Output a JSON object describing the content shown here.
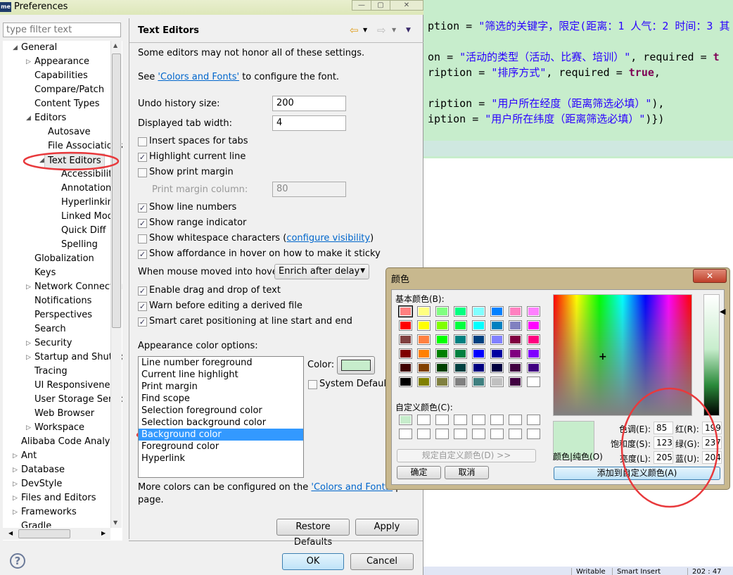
{
  "editor": {
    "bg_color": "#c7edcc",
    "lines": [
      {
        "segs": [
          [
            "ption = ",
            ""
          ],
          [
            "\"筛选的关键字，限定(距离：1 人气：2 时间：3 其",
            "s"
          ]
        ]
      },
      {
        "segs": [
          [
            "on = ",
            ""
          ],
          [
            "\"活动的类型（活动、比赛、培训）\"",
            "s"
          ],
          [
            ", required = ",
            ""
          ],
          [
            "t",
            "k"
          ]
        ]
      },
      {
        "segs": [
          [
            "ription = ",
            ""
          ],
          [
            "\"排序方式\"",
            "s"
          ],
          [
            ", required = ",
            ""
          ],
          [
            "true",
            "k"
          ],
          [
            ",",
            ""
          ]
        ]
      },
      {
        "segs": [
          [
            "ription = ",
            ""
          ],
          [
            "\"用户所在经度（距离筛选必填）\"",
            "s"
          ],
          [
            "),",
            ""
          ]
        ]
      },
      {
        "segs": [
          [
            "iption = ",
            ""
          ],
          [
            "\"用户所在纬度（距离筛选必填）\"",
            "s"
          ],
          [
            ")})",
            ""
          ]
        ]
      }
    ],
    "status": [
      "Writable",
      "Smart Insert",
      "202 : 47"
    ]
  },
  "window": {
    "title": "Preferences",
    "app_icon": "me"
  },
  "filter": {
    "placeholder": "type filter text"
  },
  "tree": [
    {
      "l": 0,
      "a": "open",
      "t": "General"
    },
    {
      "l": 1,
      "a": "closed",
      "t": "Appearance"
    },
    {
      "l": 1,
      "t": "Capabilities"
    },
    {
      "l": 1,
      "t": "Compare/Patch"
    },
    {
      "l": 1,
      "t": "Content Types"
    },
    {
      "l": 1,
      "a": "open",
      "t": "Editors"
    },
    {
      "l": 2,
      "t": "Autosave"
    },
    {
      "l": 2,
      "t": "File Associations"
    },
    {
      "l": 2,
      "a": "open",
      "t": "Text Editors",
      "sel": true
    },
    {
      "l": 3,
      "t": "Accessibility"
    },
    {
      "l": 3,
      "t": "Annotations"
    },
    {
      "l": 3,
      "t": "Hyperlinking"
    },
    {
      "l": 3,
      "t": "Linked Mode"
    },
    {
      "l": 3,
      "t": "Quick Diff"
    },
    {
      "l": 3,
      "t": "Spelling"
    },
    {
      "l": 1,
      "t": "Globalization"
    },
    {
      "l": 1,
      "t": "Keys"
    },
    {
      "l": 1,
      "a": "closed",
      "t": "Network Connections"
    },
    {
      "l": 1,
      "t": "Notifications"
    },
    {
      "l": 1,
      "t": "Perspectives"
    },
    {
      "l": 1,
      "t": "Search"
    },
    {
      "l": 1,
      "a": "closed",
      "t": "Security"
    },
    {
      "l": 1,
      "a": "closed",
      "t": "Startup and Shutdown"
    },
    {
      "l": 1,
      "t": "Tracing"
    },
    {
      "l": 1,
      "t": "UI Responsiveness"
    },
    {
      "l": 1,
      "t": "User Storage Service"
    },
    {
      "l": 1,
      "t": "Web Browser"
    },
    {
      "l": 1,
      "a": "closed",
      "t": "Workspace"
    },
    {
      "l": 0,
      "t": "Alibaba Code Analysis"
    },
    {
      "l": 0,
      "a": "closed",
      "t": "Ant"
    },
    {
      "l": 0,
      "a": "closed",
      "t": "Database"
    },
    {
      "l": 0,
      "a": "closed",
      "t": "DevStyle"
    },
    {
      "l": 0,
      "a": "closed",
      "t": "Files and Editors"
    },
    {
      "l": 0,
      "a": "closed",
      "t": "Frameworks"
    },
    {
      "l": 0,
      "t": "Gradle"
    }
  ],
  "page": {
    "title": "Text Editors",
    "note": "Some editors may not honor all of these settings.",
    "see_pre": "See ",
    "see_link": "'Colors and Fonts'",
    "see_post": " to configure the font.",
    "undo_label": "Undo history size:",
    "undo_value": "200",
    "tab_label": "Displayed tab width:",
    "tab_value": "4",
    "checks1": [
      {
        "t": "Insert spaces for tabs",
        "c": false
      },
      {
        "t": "Highlight current line",
        "c": true
      },
      {
        "t": "Show print margin",
        "c": false
      }
    ],
    "margin_label": "Print margin column:",
    "margin_value": "80",
    "checks2": [
      {
        "t": "Show line numbers",
        "c": true
      },
      {
        "t": "Show range indicator",
        "c": true
      },
      {
        "t": "Show whitespace characters",
        "c": false
      },
      {
        "t": "Show affordance in hover on how to make it sticky",
        "c": true
      }
    ],
    "ws_link": "configure visibility",
    "hover_label": "When mouse moved into hover:",
    "hover_value": "Enrich after delay",
    "checks3": [
      {
        "t": "Enable drag and drop of text",
        "c": true
      },
      {
        "t": "Warn before editing a derived file",
        "c": true
      },
      {
        "t": "Smart caret positioning at line start and end",
        "c": true
      }
    ],
    "appearance_label": "Appearance color options:",
    "color_options": [
      "Line number foreground",
      "Current line highlight",
      "Print margin",
      "Find scope",
      "Selection foreground color",
      "Selection background color",
      "Background color",
      "Foreground color",
      "Hyperlink"
    ],
    "selected_option": "Background color",
    "color_label": "Color:",
    "color_value": "#c7edcc",
    "system_default": "System Default",
    "system_default_checked": false,
    "more_pre": "More colors can be configured on the ",
    "more_link": "'Colors and Fonts'",
    "more_post": " preference",
    "more_line2": "page.",
    "restore": "Restore Defaults",
    "apply": "Apply"
  },
  "footer": {
    "ok": "OK",
    "cancel": "Cancel"
  },
  "color_dialog": {
    "title": "颜色",
    "basic_label": "基本颜色(B):",
    "basic": [
      "#ff8080",
      "#ffff80",
      "#80ff80",
      "#00ff80",
      "#80ffff",
      "#0080ff",
      "#ff80c0",
      "#ff80ff",
      "#ff0000",
      "#ffff00",
      "#80ff00",
      "#00ff40",
      "#00ffff",
      "#0080c0",
      "#8080c0",
      "#ff00ff",
      "#804040",
      "#ff8040",
      "#00ff00",
      "#008080",
      "#004080",
      "#8080ff",
      "#800040",
      "#ff0080",
      "#800000",
      "#ff8000",
      "#008000",
      "#008040",
      "#0000ff",
      "#0000a0",
      "#800080",
      "#8000ff",
      "#400000",
      "#804000",
      "#004000",
      "#004040",
      "#000080",
      "#000040",
      "#400040",
      "#400080",
      "#000000",
      "#808000",
      "#808040",
      "#808080",
      "#408080",
      "#c0c0c0",
      "#400040",
      "#ffffff"
    ],
    "custom_label": "自定义颜色(C):",
    "custom": [
      "#c7edcc",
      "#ffffff",
      "#ffffff",
      "#ffffff",
      "#ffffff",
      "#ffffff",
      "#ffffff",
      "#ffffff",
      "#ffffff",
      "#ffffff",
      "#ffffff",
      "#ffffff",
      "#ffffff",
      "#ffffff",
      "#ffffff",
      "#ffffff"
    ],
    "define_custom": "规定自定义颜色(D) >>",
    "ok": "确定",
    "cancel": "取消",
    "preview_label": "颜色|纯色(O)",
    "hue_label": "色调(E):",
    "hue": "85",
    "sat_label": "饱和度(S):",
    "sat": "123",
    "lum_label": "亮度(L):",
    "lum": "205",
    "red_label": "红(R):",
    "red": "199",
    "green_label": "绿(G):",
    "green": "237",
    "blue_label": "蓝(U):",
    "blue": "204",
    "add_custom": "添加到自定义颜色(A)",
    "close": "✕"
  },
  "annotation_color": "#e8393c"
}
